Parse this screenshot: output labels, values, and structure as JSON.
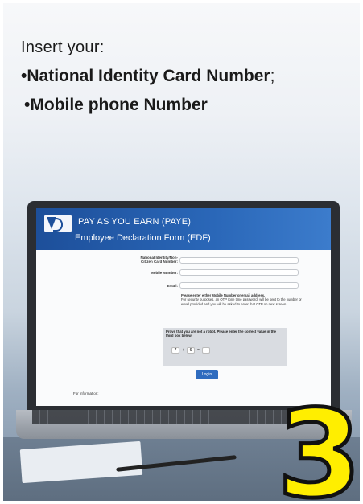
{
  "instructions": {
    "intro": "Insert your:",
    "bullet_1": "National Identity Card Number",
    "bullet_1_suffix": ";",
    "bullet_2": "Mobile phone Number",
    "bullet_symbol": "•"
  },
  "app": {
    "title": "PAY AS YOU EARN (PAYE)",
    "subtitle": "Employee Declaration Form (EDF)"
  },
  "form": {
    "nid_label_line1": "National Identity/Non-",
    "nid_label_line2": "Citizen Card Number:",
    "mobile_label": "Mobile Number:",
    "email_label": "Email:",
    "notice_title": "Please enter either Mobile Number or email address.",
    "notice_body": "For security purposes, an OTP (one time password) will be sent to the number or email provided and you will be asked to enter that OTP on next screen.",
    "captcha_prompt": "Prove that you are not a robot. Please enter the correct value in the third box below:",
    "captcha_a": "7",
    "captcha_b": "6",
    "captcha_op1": "+",
    "captcha_op2": "=",
    "login_label": "Login",
    "footer": "For information:"
  },
  "overlay": {
    "step_number": "3",
    "step_color": "#ffee00"
  }
}
